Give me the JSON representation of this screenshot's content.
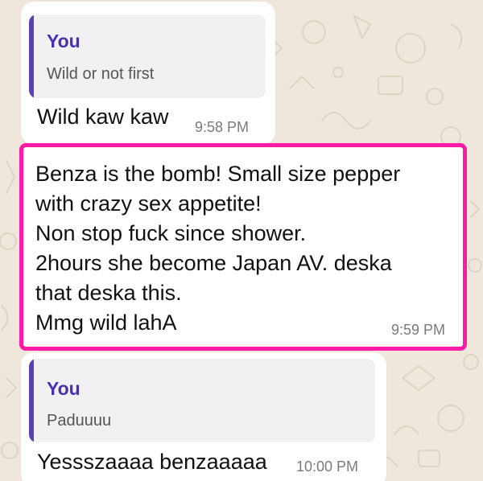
{
  "messages": [
    {
      "quote_author": "You",
      "quote_text": "Wild or not first",
      "text": "Wild kaw kaw",
      "time": "9:58 PM"
    },
    {
      "lines": [
        "Benza is the bomb! Small size pepper",
        "with crazy sex appetite!",
        "Non stop fuck since shower.",
        "2hours she become Japan AV. deska",
        "that deska this.",
        "Mmg wild lahA"
      ],
      "time": "9:59 PM",
      "highlighted": true
    },
    {
      "quote_author": "You",
      "quote_text": "Paduuuu",
      "text": "Yessszaaaa benzaaaaa",
      "time": "10:00 PM"
    }
  ],
  "colors": {
    "highlight_border": "#ff1aa8",
    "quote_author": "#4a2fb0",
    "quote_bar": "#5b3fb4",
    "chat_background": "#efe7dc"
  }
}
